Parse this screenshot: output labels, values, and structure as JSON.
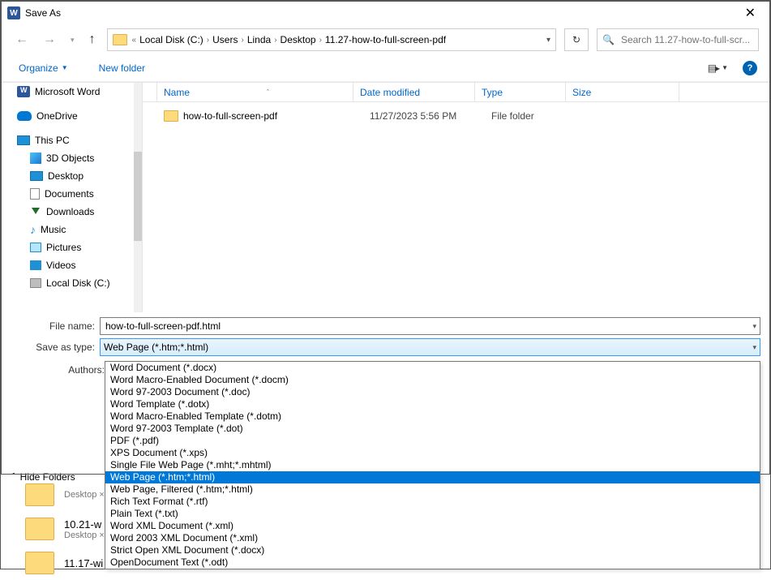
{
  "title": "Save As",
  "breadcrumb": {
    "prefix": "«",
    "items": [
      "Local Disk (C:)",
      "Users",
      "Linda",
      "Desktop",
      "11.27-how-to-full-screen-pdf"
    ]
  },
  "search": {
    "placeholder": "Search 11.27-how-to-full-scr..."
  },
  "toolbar": {
    "organize": "Organize",
    "newfolder": "New folder"
  },
  "tree": [
    {
      "id": "word",
      "label": "Microsoft Word",
      "icon": "word"
    },
    {
      "id": "onedrive",
      "label": "OneDrive",
      "icon": "onedrive"
    },
    {
      "id": "thispc",
      "label": "This PC",
      "icon": "pc"
    },
    {
      "id": "3d",
      "label": "3D Objects",
      "icon": "3d",
      "sub": true
    },
    {
      "id": "desktop",
      "label": "Desktop",
      "icon": "desktop",
      "sub": true
    },
    {
      "id": "documents",
      "label": "Documents",
      "icon": "doc",
      "sub": true
    },
    {
      "id": "downloads",
      "label": "Downloads",
      "icon": "down",
      "sub": true
    },
    {
      "id": "music",
      "label": "Music",
      "icon": "music",
      "sub": true
    },
    {
      "id": "pictures",
      "label": "Pictures",
      "icon": "pic",
      "sub": true
    },
    {
      "id": "videos",
      "label": "Videos",
      "icon": "vid",
      "sub": true
    },
    {
      "id": "localc",
      "label": "Local Disk (C:)",
      "icon": "disk",
      "sub": true
    }
  ],
  "columns": {
    "name": "Name",
    "date": "Date modified",
    "type": "Type",
    "size": "Size"
  },
  "files": [
    {
      "name": "how-to-full-screen-pdf",
      "date": "11/27/2023 5:56 PM",
      "type": "File folder",
      "size": ""
    }
  ],
  "fields": {
    "filename_label": "File name:",
    "filename_value": "how-to-full-screen-pdf.html",
    "saveastype_label": "Save as type:",
    "saveastype_value": "Web Page (*.htm;*.html)",
    "authors_label": "Authors:"
  },
  "hide_folders": "Hide Folders",
  "dropdown_options": [
    "Word Document (*.docx)",
    "Word Macro-Enabled Document (*.docm)",
    "Word 97-2003 Document (*.doc)",
    "Word Template (*.dotx)",
    "Word Macro-Enabled Template (*.dotm)",
    "Word 97-2003 Template (*.dot)",
    "PDF (*.pdf)",
    "XPS Document (*.xps)",
    "Single File Web Page (*.mht;*.mhtml)",
    "Web Page (*.htm;*.html)",
    "Web Page, Filtered (*.htm;*.html)",
    "Rich Text Format (*.rtf)",
    "Plain Text (*.txt)",
    "Word XML Document (*.xml)",
    "Word 2003 XML Document (*.xml)",
    "Strict Open XML Document (*.docx)",
    "OpenDocument Text (*.odt)"
  ],
  "dropdown_selected_index": 9,
  "bg_rows": [
    {
      "loc": "Desktop ×",
      "name": ""
    },
    {
      "loc": "Desktop ×",
      "name": "10.21-w"
    },
    {
      "loc": "",
      "name": "11.17-wi"
    }
  ]
}
